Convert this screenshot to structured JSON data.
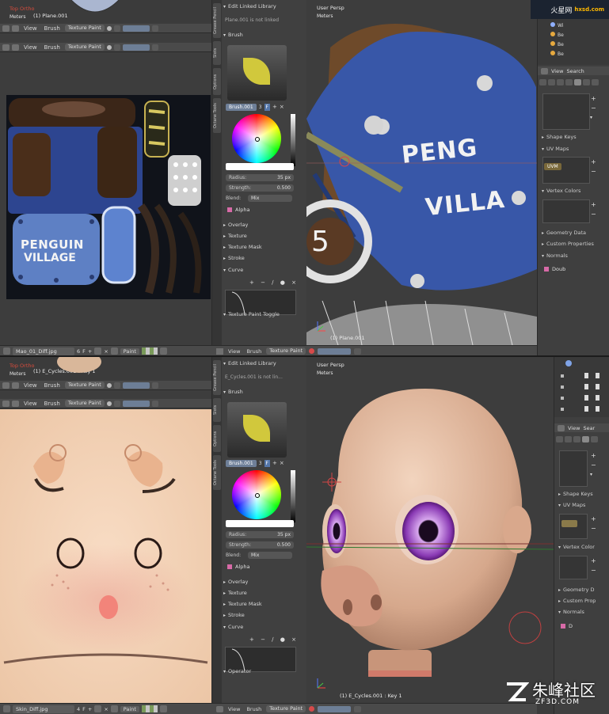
{
  "top": {
    "image_editor": {
      "view_name": "Top Ortho",
      "meters": "Meters",
      "object_label": "(1) Plane.001",
      "header1": {
        "view": "View",
        "brush": "Brush",
        "mode": "Texture Paint"
      },
      "header2": {
        "view": "View",
        "brush": "Brush",
        "mode": "Texture Paint"
      },
      "texture_text": [
        "PENGUIN",
        "VILLAGE"
      ],
      "footer": {
        "image_name": "Mao_01_Diff.jpg",
        "users": "6",
        "f": "F",
        "mode": "Paint"
      }
    },
    "tools": {
      "tabs": [
        "Grease Pencil",
        "Slots",
        "Options",
        "Octane Tools"
      ],
      "linked_section": "Edit Linked Library",
      "linked_note": "Plane.001 is not linked",
      "brush_section": "Brush",
      "brush_name": "Brush.001",
      "brush_users": "3",
      "brush_f": "F",
      "radius_label": "Radius:",
      "radius_value": "35 px",
      "strength_label": "Strength:",
      "strength_value": "0.500",
      "blend_label": "Blend:",
      "blend_value": "Mix",
      "alpha_label": "Alpha",
      "sections": [
        "Overlay",
        "Texture",
        "Texture Mask",
        "Stroke"
      ],
      "curve_section": "Curve",
      "curve_buttons": "+ − ∕ ● ×",
      "bottom_section": "Texture Paint Toggle"
    },
    "viewport": {
      "view_name": "User Persp",
      "meters": "Meters",
      "object_label": "(1) Plane.001",
      "helmet_text": [
        "PENG",
        "VILLA"
      ],
      "number": "5",
      "footer": {
        "view": "View",
        "brush": "Brush",
        "mode": "Texture Paint"
      }
    },
    "properties": {
      "outliner_items": [
        "Wi",
        "Be",
        "Be",
        "Be"
      ],
      "header": {
        "view": "View",
        "search": "Search"
      },
      "side_buttons": [
        "+",
        "−",
        "▾"
      ],
      "sections": [
        "Shape Keys",
        "UV Maps",
        "Vertex Colors",
        "Geometry Data",
        "Custom Properties",
        "Normals"
      ],
      "uv_map": "UVM",
      "normals_check": "Doub"
    }
  },
  "bottom": {
    "image_editor": {
      "view_name": "Top Ortho",
      "meters": "Meters",
      "object_label": "(1) E_Cycles.001 : Key 1",
      "header1": {
        "view": "View",
        "brush": "Brush",
        "mode": "Texture Paint"
      },
      "header2": {
        "view": "View",
        "brush": "Brush",
        "mode": "Texture Paint"
      },
      "footer": {
        "image_name": "Skin_Diff.jpg",
        "users": "4",
        "f": "F",
        "mode": "Paint"
      }
    },
    "tools": {
      "tabs": [
        "Grease Pencil",
        "Slots",
        "Options",
        "Octane Tools"
      ],
      "linked_section": "Edit Linked Library",
      "linked_note": "E_Cycles.001 is not lin...",
      "brush_section": "Brush",
      "brush_name": "Brush.001",
      "brush_users": "3",
      "brush_f": "F",
      "radius_label": "Radius:",
      "radius_value": "35 px",
      "strength_label": "Strength:",
      "strength_value": "0.500",
      "blend_label": "Blend:",
      "blend_value": "Mix",
      "alpha_label": "Alpha",
      "sections": [
        "Overlay",
        "Texture",
        "Texture Mask",
        "Stroke"
      ],
      "curve_section": "Curve",
      "curve_buttons": "+ − ∕ ● ×",
      "bottom_section": "Operator"
    },
    "viewport": {
      "view_name": "User Persp",
      "meters": "Meters",
      "object_label": "(1) E_Cycles.001 : Key 1",
      "footer": {
        "view": "View",
        "brush": "Brush",
        "mode": "Texture Paint"
      }
    },
    "properties": {
      "header": {
        "view": "View",
        "search": "Sear"
      },
      "side_buttons": [
        "+",
        "−",
        "▾"
      ],
      "sections": [
        "Shape Keys",
        "UV Maps",
        "Vertex Color",
        "Geometry D",
        "Custom Prop",
        "Normals"
      ],
      "normals_check": "D"
    }
  },
  "watermarks": {
    "top_site": "火星网",
    "top_url": "hxsd.com",
    "bottom_site": "朱峰社区",
    "bottom_url": "ZF3D.COM"
  },
  "colors": {
    "panel": "#404040",
    "header": "#4a4a4a",
    "accent_blue": "#6d7e96",
    "checkbox_pink": "#d76aa7",
    "brush_yellow": "#d1c83c"
  },
  "icons": [
    "view-menu-icon",
    "brush-icon",
    "checker-icon",
    "color-wheel",
    "plus-icon",
    "close-icon",
    "checkbox-icon",
    "editor-type-icon"
  ]
}
